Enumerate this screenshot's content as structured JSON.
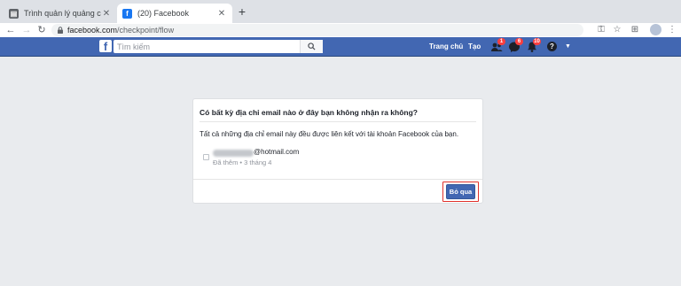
{
  "browser": {
    "tabs": [
      {
        "title": "Trình quản lý quảng cáo - Quả",
        "active": false
      },
      {
        "title": "(20) Facebook",
        "active": true
      }
    ],
    "url_host": "facebook.com",
    "url_path": "/checkpoint/flow"
  },
  "facebook": {
    "logo": "f",
    "search_placeholder": "Tìm kiếm",
    "nav": {
      "home": "Trang chủ",
      "create": "Tạo"
    },
    "badges": {
      "friends": "1",
      "messages": "6",
      "notifications": "10"
    }
  },
  "dialog": {
    "title": "Có bất kỳ địa chỉ email nào ở đây bạn không nhận ra không?",
    "description": "Tất cả những địa chỉ email này đều được liên kết với tài khoản Facebook của bạn.",
    "email_domain": "@hotmail.com",
    "email_added": "Đã thêm • 3 tháng 4",
    "skip_label": "Bỏ qua"
  },
  "colors": {
    "fb_blue": "#4267b2",
    "highlight": "#e0312b",
    "badge_red": "#fa3e3e"
  }
}
